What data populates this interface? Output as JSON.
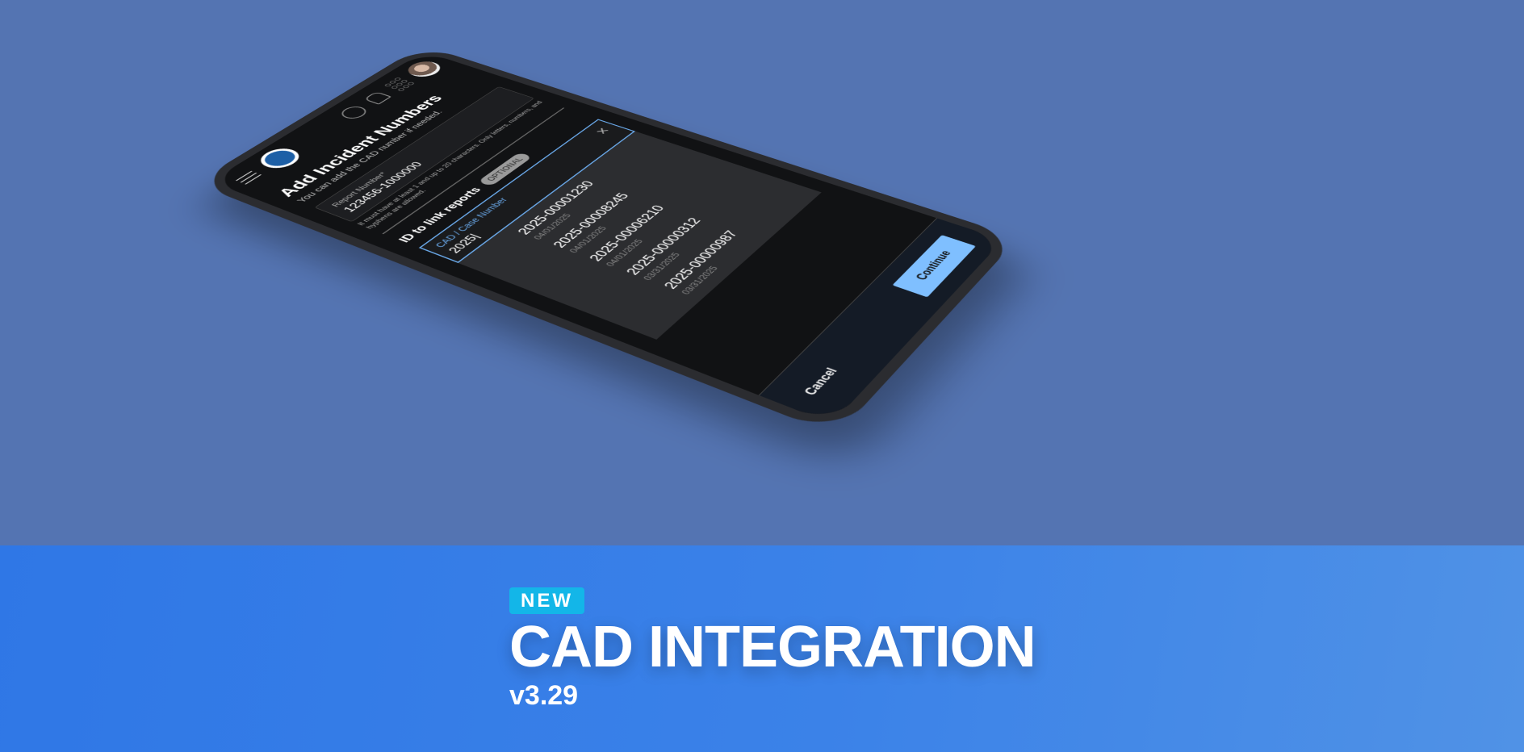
{
  "colors": {
    "background": "#5474b2",
    "band": "#3b82e8",
    "accent": "#7fbfff",
    "new_badge": "#13b6e8"
  },
  "header": {
    "icons": [
      "hamburger-icon",
      "badge-logo",
      "cloud-icon",
      "bell-icon",
      "apps-grid-icon",
      "avatar"
    ]
  },
  "page": {
    "title": "Add Incident Numbers",
    "subtitle": "You can add the CAD number if needed.",
    "report": {
      "label": "Report Number*",
      "value": "123456-1000000",
      "hint": "It must have at least 1 and up to 20 characters. Only letters, numbers, and hyphens are allowed."
    },
    "link": {
      "title": "ID to link reports",
      "badge": "OPTIONAL",
      "cad_label": "CAD / Case Number",
      "cad_value": "2025|",
      "clear_icon": "close-icon"
    },
    "options": [
      {
        "number": "2025-00001230",
        "date": "04/01/2025"
      },
      {
        "number": "2025-00008245",
        "date": "04/01/2025"
      },
      {
        "number": "2025-00006210",
        "date": "04/01/2025"
      },
      {
        "number": "2025-00000312",
        "date": "03/31/2025"
      },
      {
        "number": "2025-00000987",
        "date": "03/31/2025"
      }
    ],
    "footer": {
      "cancel": "Cancel",
      "continue": "Continue"
    }
  },
  "promo": {
    "badge": "NEW",
    "headline": "CAD INTEGRATION",
    "version": "v3.29"
  }
}
